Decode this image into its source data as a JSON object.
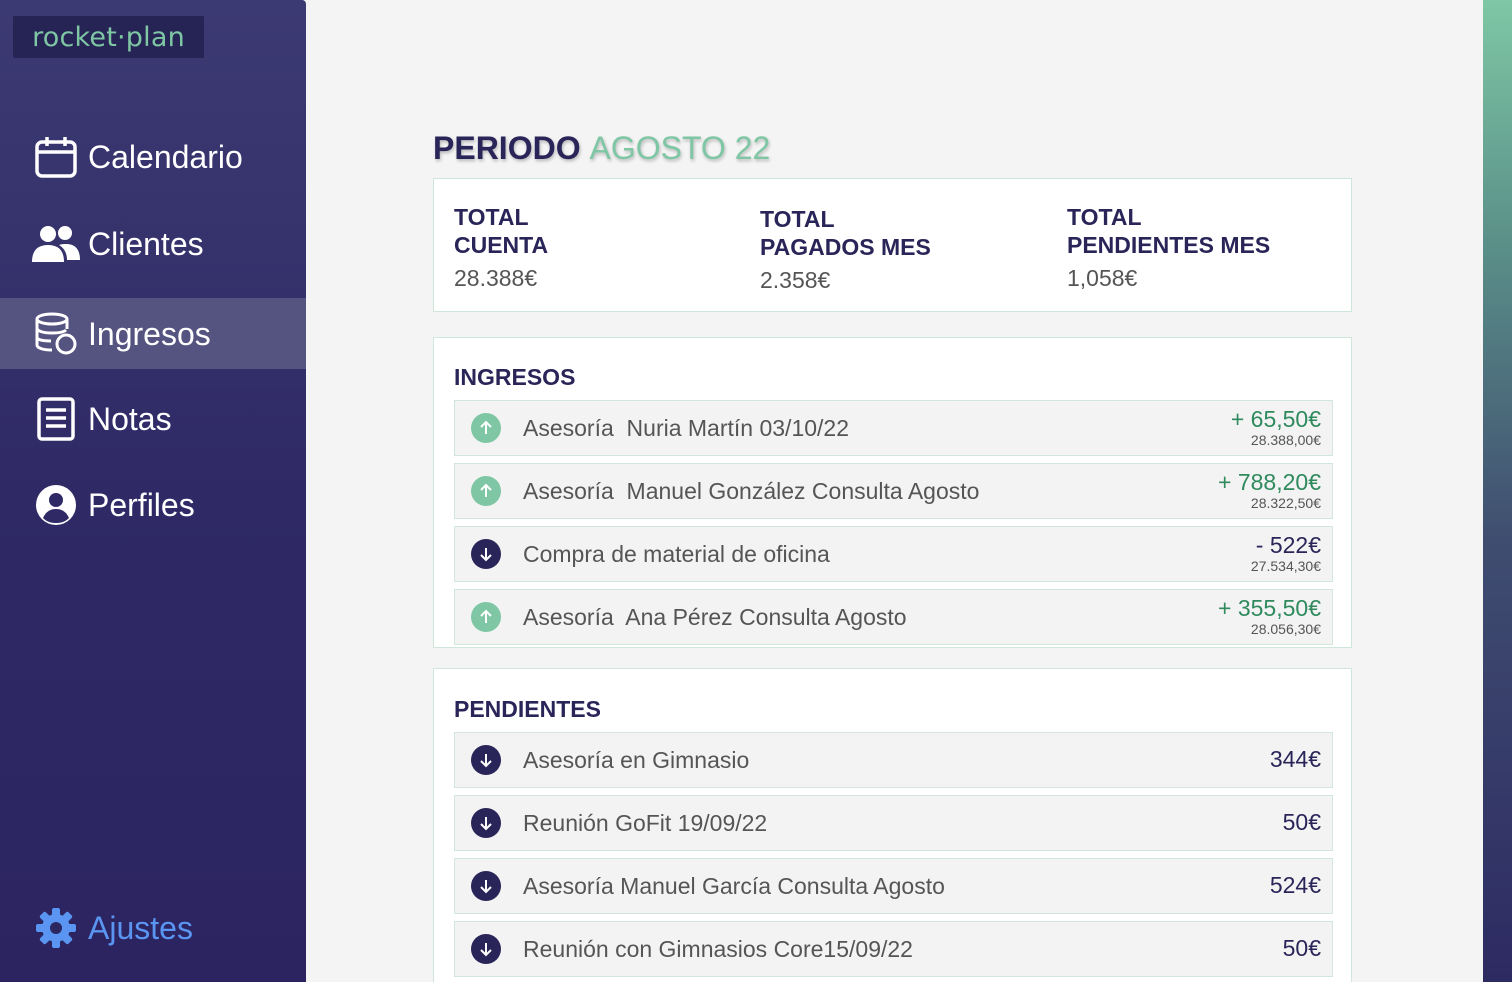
{
  "app": {
    "logo": "rocket·plan"
  },
  "sidebar": {
    "items": [
      {
        "label": "Calendario",
        "icon": "calendar-icon"
      },
      {
        "label": "Clientes",
        "icon": "users-icon"
      },
      {
        "label": "Ingresos",
        "icon": "coins-icon",
        "active": true
      },
      {
        "label": "Notas",
        "icon": "notes-icon"
      },
      {
        "label": "Perfiles",
        "icon": "profile-icon"
      }
    ],
    "settings": {
      "label": "Ajustes",
      "icon": "gear-icon"
    }
  },
  "header": {
    "title_key": "PERIODO",
    "title_value": "AGOSTO 22"
  },
  "summary": {
    "cuenta": {
      "title1": "TOTAL",
      "title2": "CUENTA",
      "value": "28.388€"
    },
    "pagados": {
      "title1": "TOTAL",
      "title2": "PAGADOS MES",
      "value": "2.358€"
    },
    "pendientes": {
      "title1": "TOTAL",
      "title2": "PENDIENTES MES",
      "value": "1,058€"
    }
  },
  "ingresos": {
    "title": "INGRESOS",
    "rows": [
      {
        "description": "Asesoría  Nuria Martín 03/10/22",
        "amount": "+ 65,50€",
        "balance": "28.388,00€",
        "direction": "up"
      },
      {
        "description": "Asesoría  Manuel González Consulta Agosto",
        "amount": "+ 788,20€",
        "balance": "28.322,50€",
        "direction": "up"
      },
      {
        "description": "Compra de material de oficina",
        "amount": "- 522€",
        "balance": "27.534,30€",
        "direction": "down"
      },
      {
        "description": "Asesoría  Ana Pérez Consulta Agosto",
        "amount": "+ 355,50€",
        "balance": "28.056,30€",
        "direction": "up"
      }
    ]
  },
  "pendientes": {
    "title": "PENDIENTES",
    "rows": [
      {
        "description": "Asesoría en Gimnasio",
        "amount": "344€",
        "direction": "down"
      },
      {
        "description": "Reunión GoFit 19/09/22",
        "amount": "50€",
        "direction": "down"
      },
      {
        "description": "Asesoría Manuel García Consulta Agosto",
        "amount": "524€",
        "direction": "down"
      },
      {
        "description": "Reunión con Gimnasios Core15/09/22",
        "amount": "50€",
        "direction": "down"
      }
    ]
  },
  "colors": {
    "sidebar": "#2f2a66",
    "accent_green": "#7ec6a4",
    "navy": "#2a2558",
    "settings_blue": "#5b95f2"
  }
}
